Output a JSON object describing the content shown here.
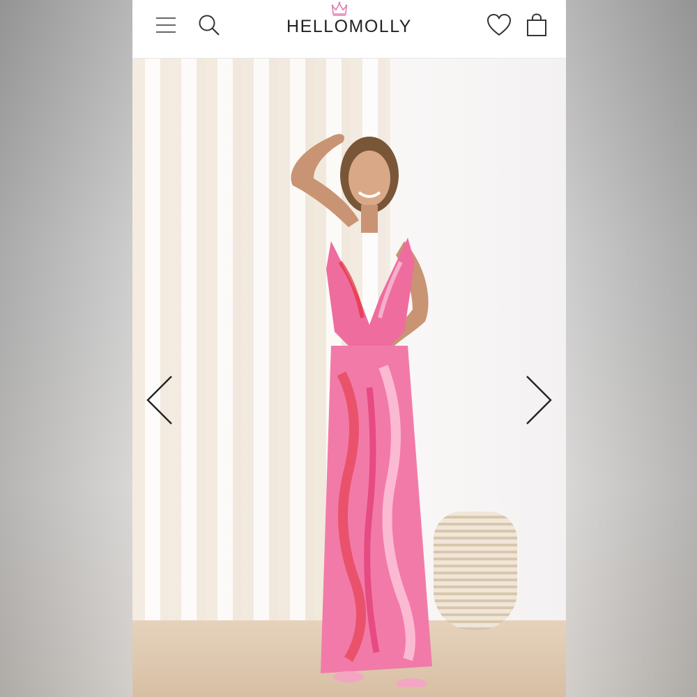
{
  "brand": {
    "logo_text": "HELLOMOLLY"
  },
  "header": {
    "icons": [
      "menu-icon",
      "search-icon",
      "heart-icon",
      "shopping-bag-icon"
    ]
  },
  "gallery": {
    "image_alt": "",
    "prev_icon": "chevron-left-icon",
    "next_icon": "chevron-right-icon"
  },
  "colors": {
    "header_bg": "#ffffff",
    "logo": "#222222",
    "crown_accent": "#e57ab0",
    "dress_primary": "#f06aa0",
    "dress_accent": "#e3313a"
  }
}
